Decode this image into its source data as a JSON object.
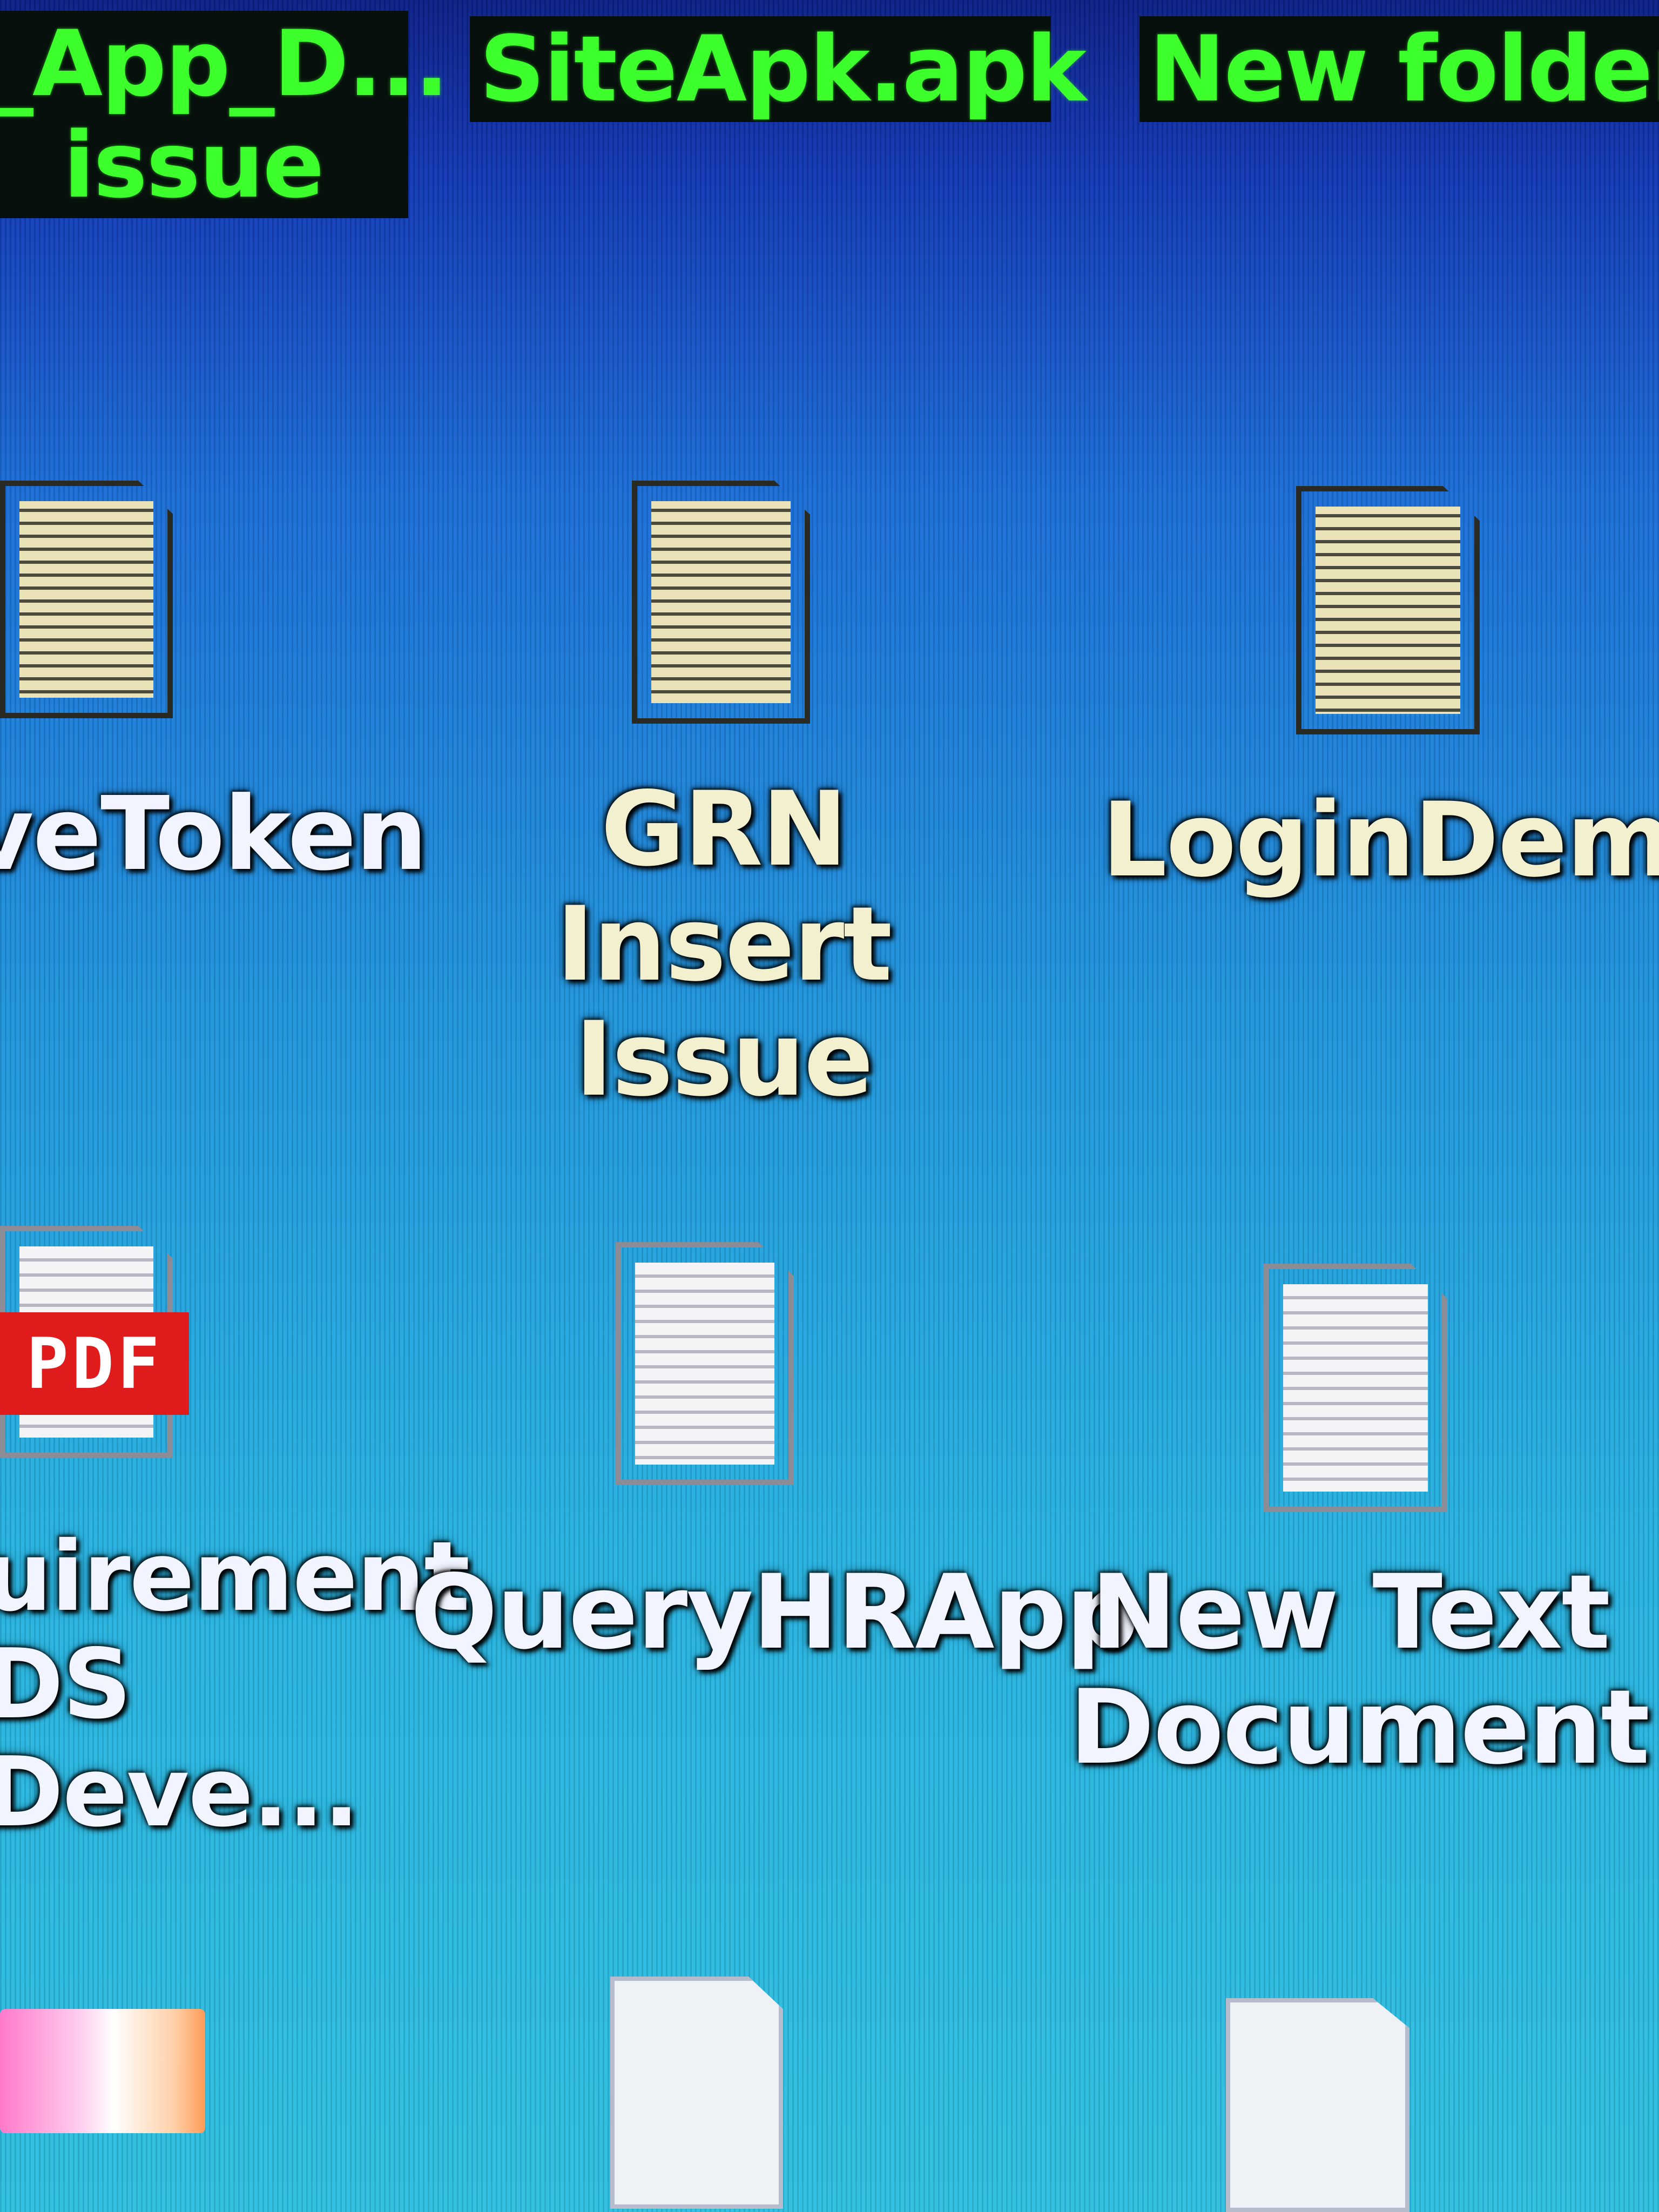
{
  "desktop": {
    "row1": [
      {
        "label": "_App_D...\nissue"
      },
      {
        "label": "SiteApk.apk"
      },
      {
        "label": "New folder"
      }
    ],
    "row2": [
      {
        "label": "veToken"
      },
      {
        "label": "GRN Insert\nIssue"
      },
      {
        "label": "LoginDemo"
      }
    ],
    "row3": [
      {
        "label": "uirement\nDS Deve...",
        "badge": "PDF"
      },
      {
        "label": "QueryHRApp"
      },
      {
        "label": "New Text\nDocument"
      }
    ]
  },
  "icons": {
    "text_file": "text-document-icon",
    "pdf_file": "pdf-document-icon",
    "generic_file": "file-icon",
    "image_file": "image-file-icon"
  },
  "colors": {
    "desktop_top": "#0b1f86",
    "desktop_bottom": "#2dbfe0",
    "selected_label": "#3cff2c",
    "pdf_badge": "#e01b1b"
  }
}
